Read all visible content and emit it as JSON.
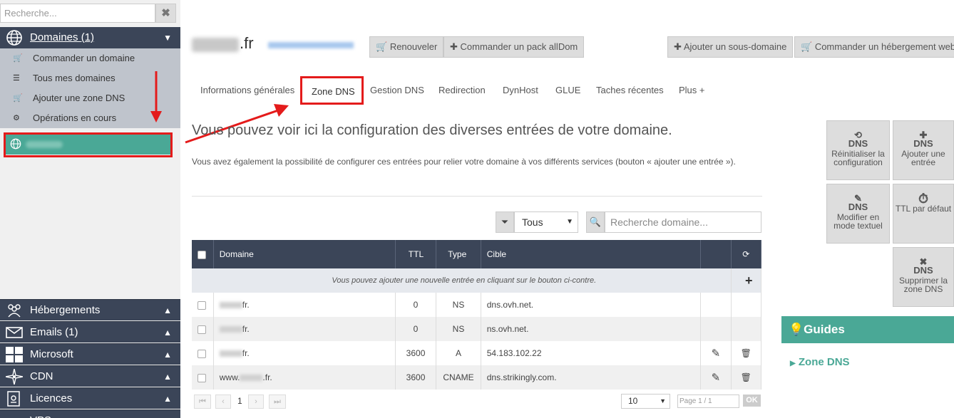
{
  "sidebar": {
    "search_placeholder": "Recherche...",
    "clear_icon": "times-icon",
    "domains_header": "Domaines (1)",
    "items": [
      {
        "icon": "cart-icon",
        "label": "Commander un domaine"
      },
      {
        "icon": "list-icon",
        "label": "Tous mes domaines"
      },
      {
        "icon": "cart-icon",
        "label": "Ajouter une zone DNS"
      },
      {
        "icon": "gears-icon",
        "label": "Opérations en cours"
      }
    ],
    "bottom": [
      {
        "icon": "users-icon",
        "label": "Hébergements"
      },
      {
        "icon": "envelope-icon",
        "label": "Emails (1)"
      },
      {
        "icon": "windows-icon",
        "label": "Microsoft"
      },
      {
        "icon": "compass-icon",
        "label": "CDN"
      },
      {
        "icon": "license-icon",
        "label": "Licences"
      },
      {
        "icon": "server-icon",
        "label": "VPS"
      }
    ]
  },
  "header": {
    "domain_suffix": ".fr",
    "buttons": [
      "Renouveler",
      "Commander un pack allDom"
    ],
    "right_buttons": [
      "Ajouter un sous-domaine",
      "Commander un hébergement web"
    ]
  },
  "tabs": [
    "Informations générales",
    "Zone DNS",
    "Gestion DNS",
    "Redirection",
    "DynHost",
    "GLUE",
    "Taches récentes",
    "Plus +"
  ],
  "main": {
    "heading": "Vous pouvez voir ici la configuration des diverses entrées de votre domaine.",
    "description": "Vous avez également la possibilité de configurer ces entrées pour relier votre domaine à vos différents services (bouton « ajouter une entrée »).",
    "filter_value": "Tous",
    "search_placeholder": "Recherche domaine..."
  },
  "table": {
    "headers": [
      "Domaine",
      "TTL",
      "Type",
      "Cible"
    ],
    "info": "Vous pouvez ajouter une nouvelle entrée en cliquant sur le bouton ci-contre.",
    "rows": [
      {
        "prefix": "",
        "suffix": "fr.",
        "ttl": "0",
        "type": "NS",
        "target": "dns.ovh.net."
      },
      {
        "prefix": "",
        "suffix": "fr.",
        "ttl": "0",
        "type": "NS",
        "target": "ns.ovh.net."
      },
      {
        "prefix": "",
        "suffix": "fr.",
        "ttl": "3600",
        "type": "A",
        "target": "54.183.102.22"
      },
      {
        "prefix": "www.",
        "suffix": ".fr.",
        "ttl": "3600",
        "type": "CNAME",
        "target": "dns.strikingly.com."
      }
    ]
  },
  "pagination": {
    "page": "1",
    "per_page": "10",
    "page_info": "Page 1 / 1",
    "ok": "OK"
  },
  "actions": [
    {
      "icon": "dns-reset-icon",
      "label": "Réinitialiser la configuration"
    },
    {
      "icon": "dns-add-icon",
      "label": "Ajouter une entrée"
    },
    {
      "icon": "dns-edit-icon",
      "label": "Modifier en mode textuel"
    },
    {
      "icon": "stopwatch-icon",
      "label": "TTL par défaut"
    },
    {
      "icon": "dns-delete-icon",
      "label": "Supprimer la zone DNS"
    }
  ],
  "guides": {
    "title": "Guides",
    "link": "Zone DNS"
  },
  "colors": {
    "nav": "#3b4558",
    "accent": "#4aa896",
    "annotation": "#e41b1b"
  }
}
